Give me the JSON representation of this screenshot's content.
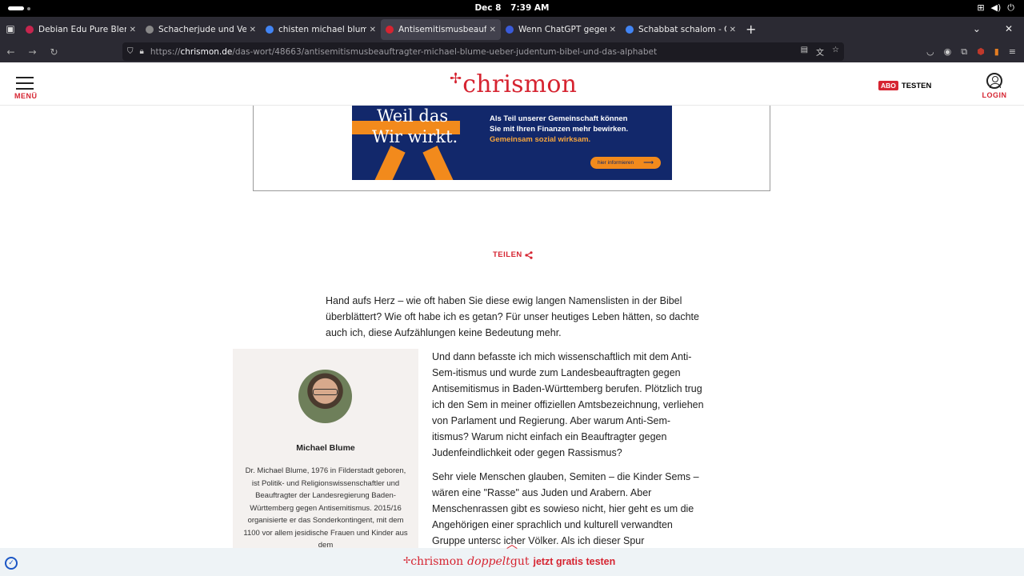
{
  "system": {
    "date": "Dec 8",
    "time": "7:39 AM"
  },
  "tabs": [
    {
      "title": "Debian Edu Pure Blend",
      "favicon_color": "#c7254e",
      "active": false
    },
    {
      "title": "Schacherjude und Versch",
      "favicon_color": "#888888",
      "active": false
    },
    {
      "title": "chisten michael blume es",
      "favicon_color": "#4285f4",
      "active": false
    },
    {
      "title": "Antisemitismusbeauftrag",
      "favicon_color": "#d62431",
      "active": true
    },
    {
      "title": "Wenn ChatGPT gegen Ju",
      "favicon_color": "#3a5bd9",
      "active": false
    },
    {
      "title": "Schabbat schalom - Goog",
      "favicon_color": "#4285f4",
      "active": false
    }
  ],
  "urlbar": {
    "scheme": "https://",
    "host": "chrismon.de",
    "path": "/das-wort/48663/antisemitismusbeauftragter-michael-blume-ueber-judentum-bibel-und-das-alphabet"
  },
  "site": {
    "menu_label": "MENÜ",
    "logo_text": "chrismon",
    "abo_badge": "ABO",
    "abo_label": "TESTEN",
    "login_label": "LOGIN"
  },
  "ad": {
    "headline_line1": "Weil das",
    "headline_line2": "Wir wirkt.",
    "text_line1": "Als Teil unserer Gemeinschaft können",
    "text_line2": "Sie mit Ihren Finanzen mehr bewirken.",
    "text_highlight": "Gemeinsam sozial wirksam.",
    "cta": "hier informieren",
    "colors": {
      "background": "#12286b",
      "accent": "#f28a1c"
    }
  },
  "share_label": "TEILEN",
  "article": {
    "intro": "Hand aufs Herz – wie oft haben Sie diese ewig langen Namenslisten in der Bibel überblättert? Wie oft habe ich es getan? Für unser heutiges Leben hätten, so dachte auch ich, diese Aufzählungen keine Bedeutung mehr.",
    "para1": "Und dann befasste ich mich wissenschaftlich mit dem Anti-Sem-itismus und wurde zum Landesbeauftragten gegen Antisemitismus in Baden-Württemberg berufen. Plötzlich trug ich den Sem in meiner offiziellen Amtsbezeichnung, verliehen von Parlament und Regierung. Aber warum Anti-Sem-itismus? Warum nicht einfach ein Beauftragter gegen Judenfeindlichkeit oder gegen Rassismus?",
    "para2": "Sehr viele Menschen glauben, Semiten – die Kinder Sems – wären eine \"Rasse\" aus Juden und Arabern. Aber Menschenrassen gibt es sowieso nicht, hier geht es um die Angehörigen einer sprachlich und kulturell verwandten Gruppe untersc    icher Völker. Als ich dieser Spur"
  },
  "author": {
    "name": "Michael Blume",
    "bio": "Dr. Michael Blume, 1976 in Filderstadt geboren, ist Politik- und Religionswissenschaftler und Beauftragter der Landesregierung Baden-Württemberg gegen Antisemitismus. 2015/16 organisierte er das Sonderkontingent, mit dem 1100 vor allem jesidische Frauen und Kinder aus dem"
  },
  "promo": {
    "logo": "chrismon",
    "italic": "doppelt",
    "word": "gut",
    "cta": "jetzt gratis testen"
  },
  "colors": {
    "brand_red": "#d62431",
    "browser_chrome": "#2b2a33"
  }
}
